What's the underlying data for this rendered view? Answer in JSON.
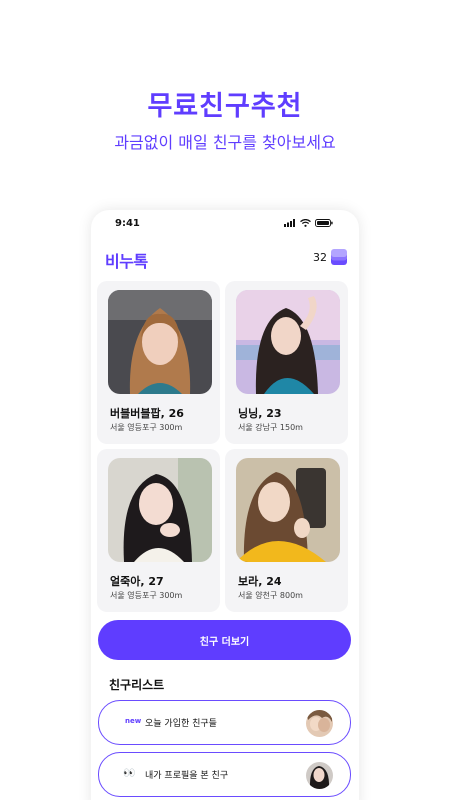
{
  "hero": {
    "title": "무료친구추천",
    "subtitle": "과금없이 매일 친구를 찾아보세요"
  },
  "status_bar": {
    "time": "9:41",
    "icons": [
      "signal-icon",
      "wifi-icon",
      "battery-icon"
    ]
  },
  "app_bar": {
    "logo": "비누톡",
    "coin_count": "32",
    "coin_icon": "coin-stack-icon"
  },
  "profiles": [
    {
      "name": "버블버블팝, 26",
      "location": "서울 영등포구 300m"
    },
    {
      "name": "닝닝, 23",
      "location": "서울 강남구 150m"
    },
    {
      "name": "얼죽아, 27",
      "location": "서울 영등포구 300m"
    },
    {
      "name": "보라, 24",
      "location": "서울 양천구 800m"
    }
  ],
  "more_button": {
    "label": "친구 더보기"
  },
  "friend_list": {
    "title": "친구리스트",
    "items": [
      {
        "tag": "new",
        "label": "오늘 가입한 친구들"
      },
      {
        "emoji": "👀",
        "label": "내가 프로필을 본 친구"
      }
    ]
  },
  "colors": {
    "accent": "#5f3dff",
    "card_bg": "#f4f4f6"
  }
}
